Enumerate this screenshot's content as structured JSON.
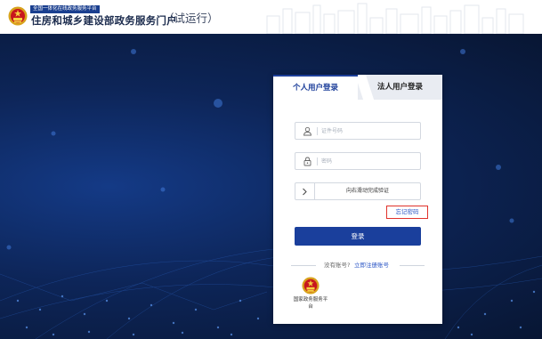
{
  "header": {
    "tag": "全国一体化在线政务服务平台",
    "title": "住房和城乡建设部政务服务门户",
    "trial": "（试运行）"
  },
  "login": {
    "tabs": [
      {
        "label": "个人用户登录",
        "active": true
      },
      {
        "label": "法人用户登录",
        "active": false
      }
    ],
    "id_placeholder": "证件号码",
    "password_placeholder": "密码",
    "slider_text": "向右滑动完成验证",
    "forgot_label": "忘记密码",
    "login_label": "登录",
    "no_account_text": "没有账号?",
    "register_label": "立即注册账号",
    "gov_platform_label": "国家政务服务平台",
    "icons": [
      "user-icon",
      "lock-icon",
      "chevron-right-icon",
      "national-emblem-icon"
    ]
  },
  "colors": {
    "primary": "#1a3f9c",
    "link": "#2a55c5",
    "highlight_border": "#e0322b",
    "background": "#0b1a3d"
  }
}
